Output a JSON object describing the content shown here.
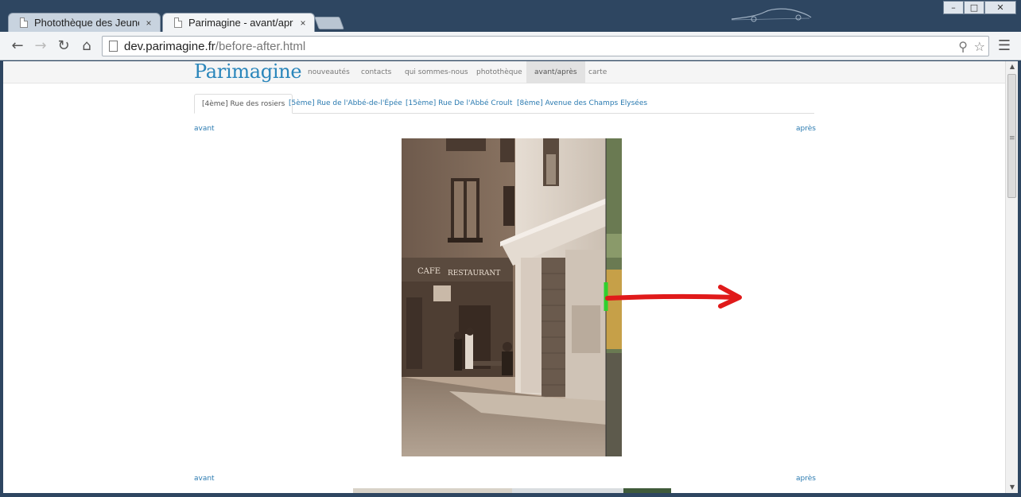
{
  "browser": {
    "tabs": [
      {
        "title": "Photothèque des Jeunes P",
        "close": "×",
        "active": false
      },
      {
        "title": "Parimagine - avant/après",
        "close": "×",
        "active": true
      }
    ],
    "window_controls": [
      "–",
      "□",
      "✕"
    ],
    "address": {
      "host": "dev.parimagine.fr",
      "path": "/before-after.html"
    }
  },
  "site": {
    "brand": "Parimagine",
    "nav": [
      {
        "label": "nouveautés",
        "active": false
      },
      {
        "label": "contacts",
        "active": false
      },
      {
        "label": "qui sommes-nous",
        "active": false
      },
      {
        "label": "photothèque",
        "active": false
      },
      {
        "label": "avant/après",
        "active": true
      },
      {
        "label": "carte",
        "active": false
      }
    ],
    "subtabs": [
      {
        "label": "[4ème] Rue des rosiers",
        "active": true
      },
      {
        "label": "[5ème] Rue de l'Abbé-de-l'Épée",
        "active": false
      },
      {
        "label": "[15ème] Rue De l'Abbé Croult",
        "active": false
      },
      {
        "label": "[8ème] Avenue des Champs Elysées",
        "active": false
      }
    ],
    "before_label": "avant",
    "after_label": "après",
    "photo_caption_1": "CAFE",
    "photo_caption_2": "RESTAURANT"
  },
  "colors": {
    "brand": "#2a86bb",
    "link": "#2a7ab0",
    "arrow": "#e01a1a",
    "handle": "#2ed12e",
    "titlebar": "#2e4661"
  }
}
